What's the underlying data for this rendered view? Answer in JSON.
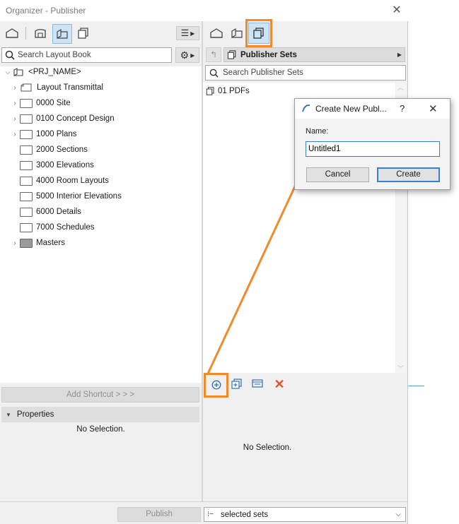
{
  "window": {
    "title": "Organizer - Publisher"
  },
  "left_panel": {
    "search_placeholder": "Search Layout Book",
    "tree": {
      "root": "<PRJ_NAME>",
      "items": [
        {
          "label": "Layout Transmittal",
          "type": "layout"
        },
        {
          "label": "0000 Site",
          "type": "folder",
          "expandable": true
        },
        {
          "label": "0100 Concept Design",
          "type": "folder",
          "expandable": true
        },
        {
          "label": "1000 Plans",
          "type": "folder",
          "expandable": true
        },
        {
          "label": "2000 Sections",
          "type": "folder",
          "expandable": false
        },
        {
          "label": "3000 Elevations",
          "type": "folder",
          "expandable": false
        },
        {
          "label": "4000 Room Layouts",
          "type": "folder",
          "expandable": false
        },
        {
          "label": "5000 Interior Elevations",
          "type": "folder",
          "expandable": false
        },
        {
          "label": "6000 Details",
          "type": "folder",
          "expandable": false
        },
        {
          "label": "7000 Schedules",
          "type": "folder",
          "expandable": false
        },
        {
          "label": "Masters",
          "type": "master-folder",
          "expandable": true
        }
      ]
    },
    "add_shortcut_label": "Add Shortcut > > >",
    "properties_label": "Properties",
    "no_selection": "No Selection."
  },
  "right_panel": {
    "dropdown_label": "Publisher Sets",
    "search_placeholder": "Search Publisher Sets",
    "sets": [
      {
        "label": "01 PDFs"
      }
    ],
    "no_selection": "No Selection."
  },
  "footer": {
    "publish_label": "Publish",
    "selected_sets_label": "selected sets"
  },
  "dialog": {
    "title": "Create New Publ...",
    "help": "?",
    "name_label": "Name:",
    "name_value": "Untitled1",
    "cancel_label": "Cancel",
    "create_label": "Create"
  },
  "colors": {
    "highlight": "#f08a2c",
    "accent": "#3c7fd1",
    "active_bg": "#cde4f7"
  }
}
